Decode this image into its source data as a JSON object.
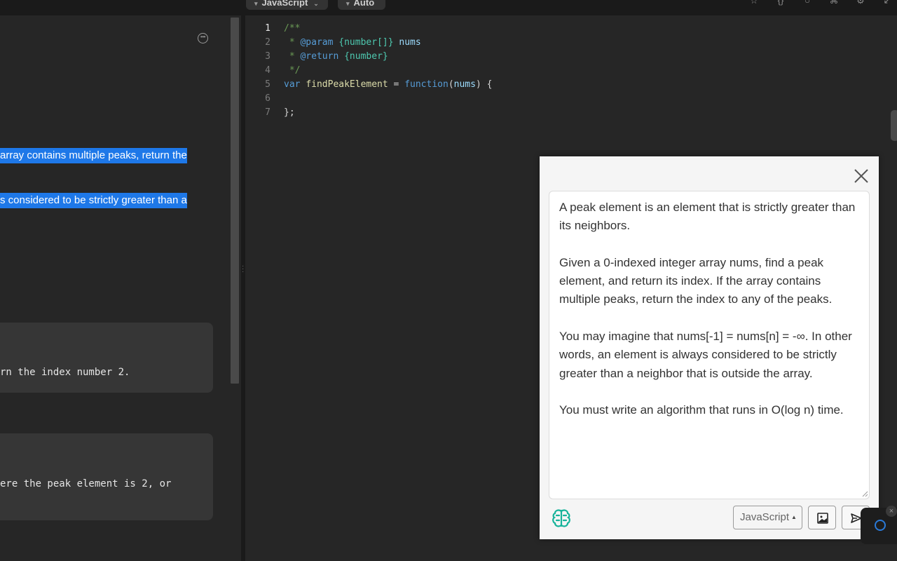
{
  "topbar": {
    "language_label": "JavaScript",
    "mode_label": "Auto",
    "icons": [
      "bookmark-icon",
      "braces-icon",
      "reset-icon",
      "shortcut-icon",
      "settings-icon",
      "expand-icon"
    ]
  },
  "description": {
    "highlight_1": "array contains multiple peaks, return the",
    "highlight_2": "s considered to be strictly greater than a",
    "example_1_line": "rn the index number 2.",
    "example_2_line": "ere the peak element is 2, or"
  },
  "editor": {
    "lines": [
      {
        "num": "1",
        "parts": [
          {
            "t": "/**",
            "c": "comment"
          }
        ]
      },
      {
        "num": "2",
        "parts": [
          {
            "t": " * ",
            "c": "comment"
          },
          {
            "t": "@param",
            "c": "tag"
          },
          {
            "t": " {number[]} ",
            "c": "type"
          },
          {
            "t": "nums",
            "c": "name"
          }
        ]
      },
      {
        "num": "3",
        "parts": [
          {
            "t": " * ",
            "c": "comment"
          },
          {
            "t": "@return",
            "c": "tag"
          },
          {
            "t": " {number}",
            "c": "type"
          }
        ]
      },
      {
        "num": "4",
        "parts": [
          {
            "t": " */",
            "c": "comment"
          }
        ]
      },
      {
        "num": "5",
        "parts": [
          {
            "t": "var ",
            "c": "kw"
          },
          {
            "t": "findPeakElement",
            "c": "fn"
          },
          {
            "t": " = ",
            "c": "plain"
          },
          {
            "t": "function",
            "c": "kw"
          },
          {
            "t": "(",
            "c": "plain"
          },
          {
            "t": "nums",
            "c": "name"
          },
          {
            "t": ") {",
            "c": "plain"
          }
        ]
      },
      {
        "num": "6",
        "parts": [
          {
            "t": "",
            "c": "plain"
          }
        ]
      },
      {
        "num": "7",
        "parts": [
          {
            "t": "};",
            "c": "plain"
          }
        ]
      }
    ]
  },
  "popup": {
    "prompt_text": "A peak element is an element that is strictly greater than its neighbors.\n\nGiven a 0-indexed integer array nums, find a peak element, and return its index. If the array contains multiple peaks, return the index to any of the peaks.\n\nYou may imagine that nums[-1] = nums[n] = -∞. In other words, an element is always considered to be strictly greater than a neighbor that is outside the array.\n\nYou must write an algorithm that runs in O(log n) time.",
    "language_select": "JavaScript",
    "accent_color": "#16b39a"
  }
}
